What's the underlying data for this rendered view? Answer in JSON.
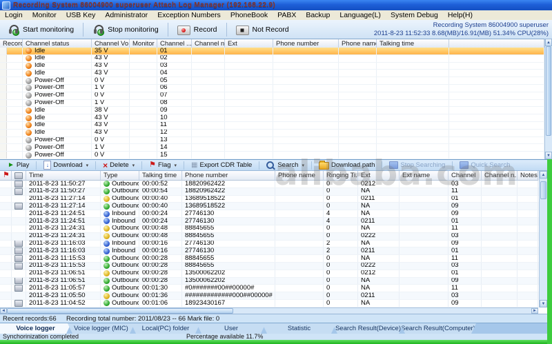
{
  "window": {
    "title": "Recording System 86004900 superuser Attach Log Manager (192.168.22.9)"
  },
  "menu": {
    "items": [
      "Login",
      "Monitor",
      "USB Key",
      "Administrator",
      "Exception Numbers",
      "PhoneBook",
      "PABX",
      "Backup",
      "Language(L)",
      "System Debug",
      "Help(H)"
    ]
  },
  "toolbar": {
    "buttons": [
      {
        "label": "Start monitoring",
        "icon": "headset-start-icon"
      },
      {
        "label": "Stop monitoring",
        "icon": "headset-stop-icon"
      },
      {
        "label": "Record",
        "icon": "record-icon"
      },
      {
        "label": "Not Record",
        "icon": "not-record-icon"
      }
    ],
    "info_line1": "Recording System 86004900 superuser",
    "info_line2": "2011-8-23 11:52:33  8.68(MB)/16.91(MB) 51.34% CPU(28%)"
  },
  "channel_table": {
    "columns": [
      "Record...",
      "Channel status",
      "Channel Vo...",
      "Monitor",
      "Channel ...",
      "Channel na...",
      "Ext",
      "Phone number",
      "Phone name",
      "Talking time"
    ],
    "rows": [
      {
        "status": "Idle",
        "state": "idle",
        "voltage": "35 V",
        "channel": "01",
        "selected": true
      },
      {
        "status": "Idle",
        "state": "idle",
        "voltage": "43 V",
        "channel": "02"
      },
      {
        "status": "Idle",
        "state": "idle",
        "voltage": "43 V",
        "channel": "03"
      },
      {
        "status": "Idle",
        "state": "idle",
        "voltage": "43 V",
        "channel": "04"
      },
      {
        "status": "Power-Off",
        "state": "off",
        "voltage": "0 V",
        "channel": "05"
      },
      {
        "status": "Power-Off",
        "state": "off",
        "voltage": "1 V",
        "channel": "06"
      },
      {
        "status": "Power-Off",
        "state": "off",
        "voltage": "0 V",
        "channel": "07"
      },
      {
        "status": "Power-Off",
        "state": "off",
        "voltage": "1 V",
        "channel": "08"
      },
      {
        "status": "Idle",
        "state": "idle",
        "voltage": "38 V",
        "channel": "09"
      },
      {
        "status": "Idle",
        "state": "idle",
        "voltage": "43 V",
        "channel": "10"
      },
      {
        "status": "Idle",
        "state": "idle",
        "voltage": "43 V",
        "channel": "11"
      },
      {
        "status": "Idle",
        "state": "idle",
        "voltage": "43 V",
        "channel": "12"
      },
      {
        "status": "Power-Off",
        "state": "off",
        "voltage": "0 V",
        "channel": "13"
      },
      {
        "status": "Power-Off",
        "state": "off",
        "voltage": "1 V",
        "channel": "14"
      },
      {
        "status": "Power-Off",
        "state": "off",
        "voltage": "0 V",
        "channel": "15"
      }
    ]
  },
  "record_toolbar": {
    "buttons": [
      {
        "label": "Play",
        "icon": "play-icon"
      },
      {
        "label": "Download",
        "icon": "download-icon",
        "dropdown": true
      },
      {
        "label": "Delete",
        "icon": "delete-icon",
        "dropdown": true
      },
      {
        "label": "Flag",
        "icon": "flag-icon",
        "dropdown": true
      },
      {
        "label": "Export CDR Table",
        "icon": "export-table-icon"
      },
      {
        "label": "Search",
        "icon": "search-icon",
        "dropdown": true
      },
      {
        "label": "Download path",
        "icon": "folder-icon"
      },
      {
        "label": "Stop Searching",
        "icon": "stop-search-icon",
        "disabled": true
      },
      {
        "label": "Quick Search",
        "icon": "quick-search-icon",
        "disabled": true
      }
    ]
  },
  "call_table": {
    "columns": [
      "Time",
      "Type",
      "Talking time",
      "Phone number",
      "Phone name",
      "Ringing Ti...",
      "Ext",
      "Ext name",
      "Channel",
      "Channel n...",
      "Notes"
    ],
    "rows": [
      {
        "disk": true,
        "time": "2011-8-23 11:50:27",
        "type": "Outbound",
        "dir": "green",
        "talking": "00:00:52",
        "phone": "18820962422",
        "ringing": "0",
        "ext": "0212",
        "channel": "03"
      },
      {
        "disk": true,
        "time": "2011-8-23 11:50:27",
        "type": "Outbound",
        "dir": "green",
        "talking": "00:00:54",
        "phone": "18820962422",
        "ringing": "0",
        "ext": "NA",
        "channel": "11"
      },
      {
        "disk": false,
        "time": "2011-8-23 11:27:14",
        "type": "Outbound",
        "dir": "yellow",
        "talking": "00:00:40",
        "phone": "13689518522",
        "ringing": "0",
        "ext": "0211",
        "channel": "01"
      },
      {
        "disk": true,
        "time": "2011-8-23 11:27:14",
        "type": "Outbound",
        "dir": "green",
        "talking": "00:00:40",
        "phone": "13689518522",
        "ringing": "0",
        "ext": "NA",
        "channel": "09"
      },
      {
        "disk": false,
        "time": "2011-8-23 11:24:51",
        "type": "Inbound",
        "dir": "blue",
        "talking": "00:00:24",
        "phone": "27746130",
        "ringing": "4",
        "ext": "NA",
        "channel": "09"
      },
      {
        "disk": false,
        "time": "2011-8-23 11:24:51",
        "type": "Inbound",
        "dir": "blue",
        "talking": "00:00:24",
        "phone": "27746130",
        "ringing": "4",
        "ext": "0211",
        "channel": "01"
      },
      {
        "disk": false,
        "time": "2011-8-23 11:24:31",
        "type": "Outbound",
        "dir": "yellow",
        "talking": "00:00:48",
        "phone": "88845655",
        "ringing": "0",
        "ext": "NA",
        "channel": "11"
      },
      {
        "disk": false,
        "time": "2011-8-23 11:24:31",
        "type": "Outbound",
        "dir": "yellow",
        "talking": "00:00:48",
        "phone": "88845655",
        "ringing": "0",
        "ext": "0222",
        "channel": "03"
      },
      {
        "disk": true,
        "time": "2011-8-23 11:16:03",
        "type": "Inbound",
        "dir": "blue",
        "talking": "00:00:16",
        "phone": "27746130",
        "ringing": "2",
        "ext": "NA",
        "channel": "09"
      },
      {
        "disk": true,
        "time": "2011-8-23 11:16:03",
        "type": "Inbound",
        "dir": "blue",
        "talking": "00:00:16",
        "phone": "27746130",
        "ringing": "2",
        "ext": "0211",
        "channel": "01"
      },
      {
        "disk": true,
        "time": "2011-8-23 11:15:53",
        "type": "Outbound",
        "dir": "green",
        "talking": "00:00:28",
        "phone": "88845655",
        "ringing": "0",
        "ext": "NA",
        "channel": "11"
      },
      {
        "disk": true,
        "time": "2011-8-23 11:15:53",
        "type": "Outbound",
        "dir": "green",
        "talking": "00:00:28",
        "phone": "88845655",
        "ringing": "0",
        "ext": "0222",
        "channel": "03"
      },
      {
        "disk": false,
        "time": "2011-8-23 11:06:51",
        "type": "Outbound",
        "dir": "yellow",
        "talking": "00:00:28",
        "phone": "13500062202",
        "ringing": "0",
        "ext": "0212",
        "channel": "01"
      },
      {
        "disk": true,
        "time": "2011-8-23 11:06:51",
        "type": "Outbound",
        "dir": "green",
        "talking": "00:00:28",
        "phone": "13500062202",
        "ringing": "0",
        "ext": "NA",
        "channel": "09"
      },
      {
        "disk": true,
        "time": "2011-8-23 11:05:57",
        "type": "Outbound",
        "dir": "green",
        "talking": "00:01:30",
        "phone": "#0#######00##00000#",
        "ringing": "0",
        "ext": "NA",
        "channel": "11"
      },
      {
        "disk": false,
        "time": "2011-8-23 11:05:50",
        "type": "Outbound",
        "dir": "yellow",
        "talking": "00:01:36",
        "phone": "#############000##00000#",
        "ringing": "0",
        "ext": "0211",
        "channel": "03"
      },
      {
        "disk": true,
        "time": "2011-8-23 11:04:52",
        "type": "Outbound",
        "dir": "green",
        "talking": "00:01:06",
        "phone": "18923430167",
        "ringing": "0",
        "ext": "NA",
        "channel": "09"
      }
    ]
  },
  "status_bar": {
    "recent": "Recent records:66",
    "total": "Recording total number: 2011/08/23 -- 66 Mark file: 0"
  },
  "tabs": [
    {
      "label": "Voice logger",
      "active": true
    },
    {
      "label": "Voice logger (MIC)"
    },
    {
      "label": "Local(PC) folder"
    },
    {
      "label": "User"
    },
    {
      "label": "Statistic"
    },
    {
      "label": "Search Result(Device)"
    },
    {
      "label": "Search Result(Computer)"
    }
  ],
  "footer": {
    "sync": "Synchorinization completed",
    "percentage": "Percentage available 11.7%"
  },
  "watermark": "alibaba.com",
  "colors": {
    "selected_row": "#ffb44a",
    "idle_status": "#ef7f16",
    "power_off_status": "#9c9c9c",
    "outbound_green": "#27a527",
    "outbound_yellow": "#ddb018",
    "inbound_blue": "#2b58cf",
    "progress_green": "#2ecc2e"
  }
}
